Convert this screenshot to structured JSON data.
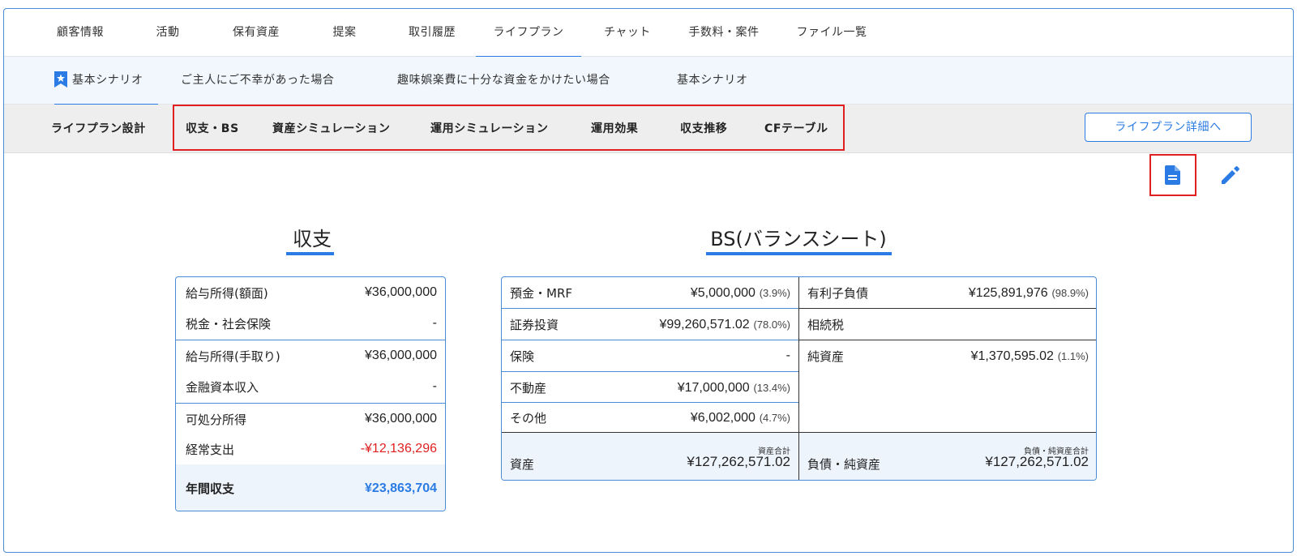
{
  "top_tabs": [
    "顧客情報",
    "活動",
    "保有資産",
    "提案",
    "取引履歴",
    "ライフプラン",
    "チャット",
    "手数料・案件",
    "ファイル一覧"
  ],
  "active_top_tab": "ライフプラン",
  "scenario_tabs": [
    "基本シナリオ",
    "ご主人にご不幸があった場合",
    "趣味娯楽費に十分な資金をかけたい場合",
    "基本シナリオ"
  ],
  "sub_tabs": [
    "ライフプラン設計",
    "収支・BS",
    "資産シミュレーション",
    "運用シミュレーション",
    "運用効果",
    "収支推移",
    "CFテーブル"
  ],
  "detail_button": "ライフプラン詳細へ",
  "income": {
    "title": "収支",
    "rows": [
      {
        "label": "給与所得(額面)",
        "value": "¥36,000,000"
      },
      {
        "label": "税金・社会保険",
        "value": "-"
      },
      {
        "label": "給与所得(手取り)",
        "value": "¥36,000,000"
      },
      {
        "label": "金融資本収入",
        "value": "-"
      },
      {
        "label": "可処分所得",
        "value": "¥36,000,000"
      },
      {
        "label": "経常支出",
        "value": "-¥12,136,296"
      }
    ],
    "total_label": "年間収支",
    "total_value": "¥23,863,704"
  },
  "bs": {
    "title": "BS(バランスシート)",
    "assets": [
      {
        "label": "預金・MRF",
        "value": "¥5,000,000",
        "pct": "(3.9%)"
      },
      {
        "label": "証券投資",
        "value": "¥99,260,571.02",
        "pct": "(78.0%)"
      },
      {
        "label": "保険",
        "value": "-",
        "pct": ""
      },
      {
        "label": "不動産",
        "value": "¥17,000,000",
        "pct": "(13.4%)"
      },
      {
        "label": "その他",
        "value": "¥6,002,000",
        "pct": "(4.7%)"
      }
    ],
    "liabilities": [
      {
        "label": "有利子負債",
        "value": "¥125,891,976",
        "pct": "(98.9%)"
      },
      {
        "label": "相続税",
        "value": "",
        "pct": ""
      },
      {
        "label": "純資産",
        "value": "¥1,370,595.02",
        "pct": "(1.1%)"
      }
    ],
    "assets_total_label": "資産",
    "assets_total_caption": "資産合計",
    "assets_total_value": "¥127,262,571.02",
    "liab_total_label": "負債・純資産",
    "liab_total_caption": "負債・純資産合計",
    "liab_total_value": "¥127,262,571.02"
  },
  "colors": {
    "accent": "#2b7be4",
    "highlight": "#e02020",
    "negative": "#e02020"
  },
  "icons": {
    "scenario": "bookmark-star-icon",
    "document": "document-icon",
    "edit": "pencil-icon"
  }
}
